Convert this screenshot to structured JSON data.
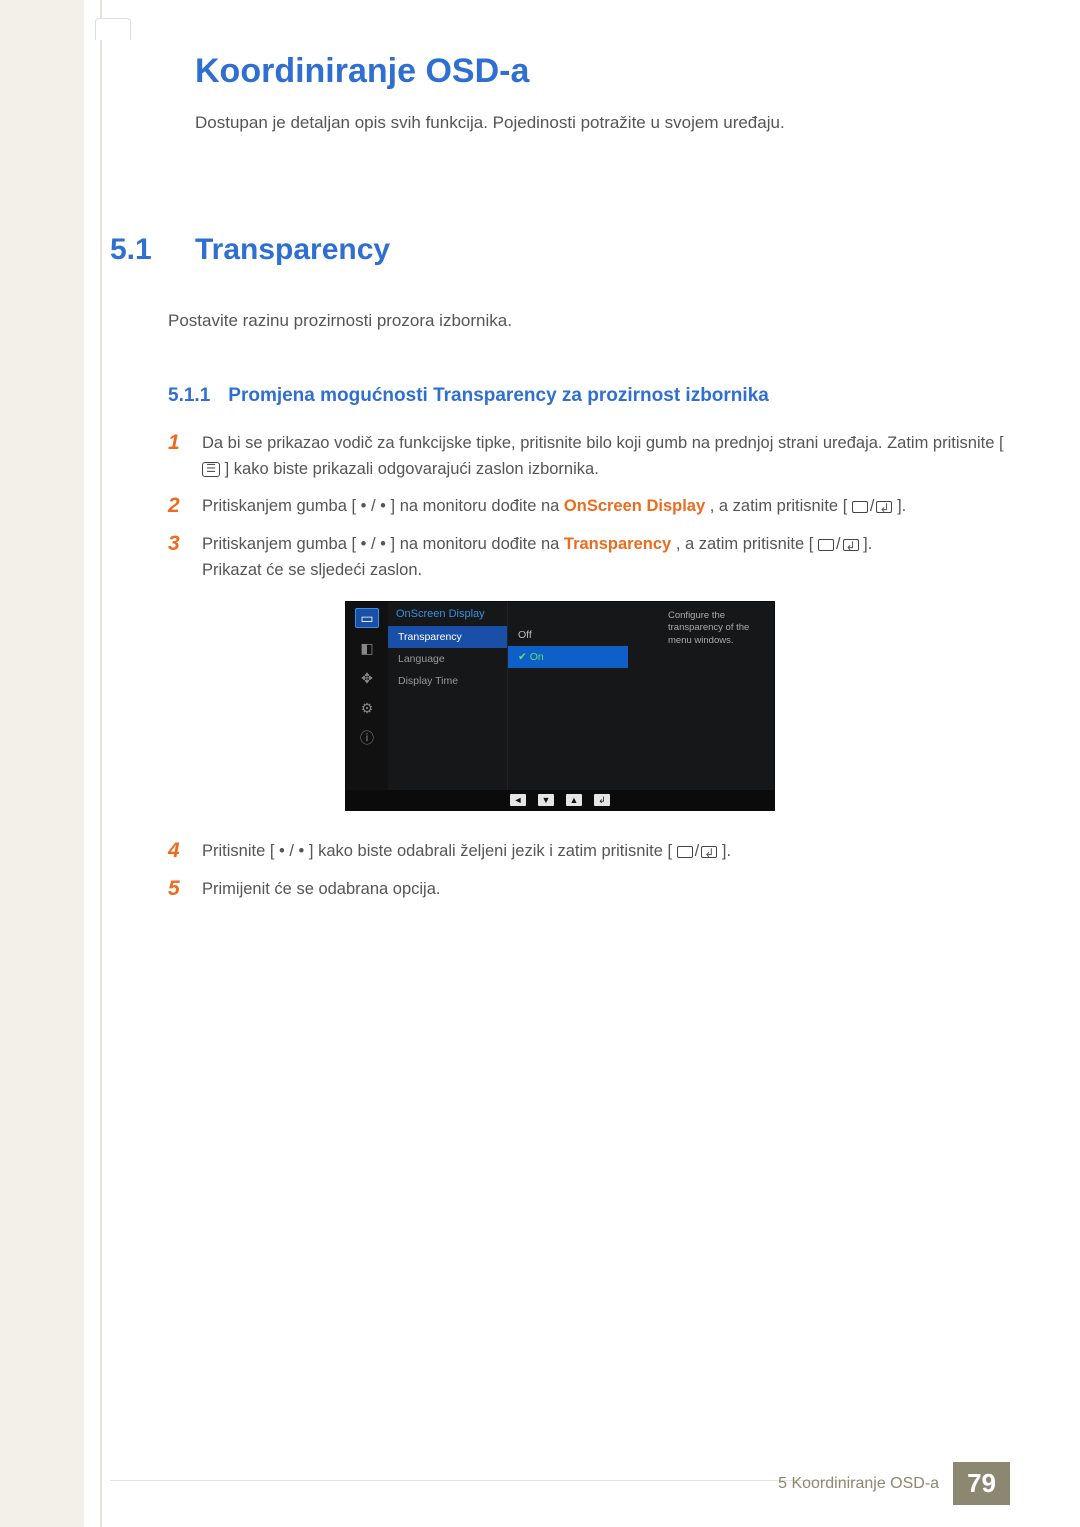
{
  "chapter": {
    "title": "Koordiniranje OSD-a",
    "description": "Dostupan je detaljan opis svih funkcija. Pojedinosti potražite u svojem uređaju."
  },
  "section": {
    "number": "5.1",
    "title": "Transparency",
    "description": "Postavite razinu prozirnosti prozora izbornika."
  },
  "subsection": {
    "number": "5.1.1",
    "title": "Promjena mogućnosti Transparency za prozirnost izbornika"
  },
  "steps": [
    {
      "n": "1",
      "pre": "Da bi se prikazao vodič za funkcijske tipke, pritisnite bilo koji gumb na prednjoj strani uređaja. Zatim pritisnite [",
      "post": "] kako biste prikazali odgovarajući zaslon izbornika."
    },
    {
      "n": "2",
      "pre": "Pritiskanjem gumba [ • / • ] na monitoru dođite na ",
      "term": "OnScreen Display",
      "mid": ", a zatim pritisnite [",
      "post": "]."
    },
    {
      "n": "3",
      "pre": "Pritiskanjem gumba [ • / • ] na monitoru dođite na ",
      "term": "Transparency",
      "mid": ", a zatim pritisnite [",
      "post": "].",
      "tail": "Prikazat će se sljedeći zaslon."
    },
    {
      "n": "4",
      "pre": "Pritisnite [ • / • ] kako biste odabrali željeni jezik i zatim pritisnite [",
      "post": "]."
    },
    {
      "n": "5",
      "pre": "Primijenit će se odabrana opcija."
    }
  ],
  "osd": {
    "menuTitle": "OnScreen Display",
    "items": [
      "Transparency",
      "Language",
      "Display Time"
    ],
    "values": [
      "Off",
      "On"
    ],
    "help": "Configure the transparency of the menu windows.",
    "nav": [
      "◄",
      "▼",
      "▲",
      "↲"
    ]
  },
  "footer": {
    "text": "5 Koordiniranje OSD-a",
    "page": "79"
  }
}
